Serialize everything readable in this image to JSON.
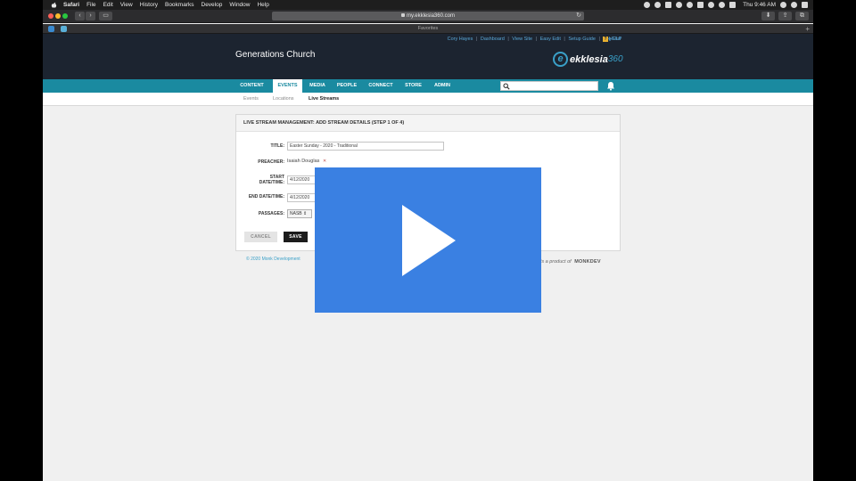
{
  "menubar": {
    "app": "Safari",
    "items": [
      "File",
      "Edit",
      "View",
      "History",
      "Bookmarks",
      "Develop",
      "Window",
      "Help"
    ],
    "clock": "Thu 9:46 AM"
  },
  "toolbar": {
    "url": "my.ekklesia360.com"
  },
  "favorites": {
    "label": "Favorites"
  },
  "header": {
    "user": "Cory Hayes",
    "links": [
      "Dashboard",
      "View Site",
      "Easy Edit",
      "Setup Guide",
      "Log Out"
    ],
    "help": "HELP",
    "church": "Generations Church",
    "brand_name": "ekklesia",
    "brand_num": "360"
  },
  "nav": {
    "items": [
      "CONTENT",
      "EVENTS",
      "MEDIA",
      "PEOPLE",
      "CONNECT",
      "STORE",
      "ADMIN"
    ],
    "active": "EVENTS",
    "search_placeholder": ""
  },
  "subnav": {
    "items": [
      "Events",
      "Locations",
      "Live Streams"
    ],
    "active": "Live Streams"
  },
  "panel": {
    "title": "LIVE STREAM MANAGEMENT: ADD STREAM DETAILS (STEP 1 OF 4)",
    "title_label": "TITLE:",
    "title_value": "Easter Sunday - 2020 - Traditional",
    "preacher_label": "PREACHER:",
    "preacher_value": "Isaiah Douglas",
    "preacher_remove": "✕",
    "start_label_1": "START",
    "start_label_2": "DATE/TIME:",
    "start_date": "4/12/2020",
    "end_label": "END DATE/TIME:",
    "end_date": "4/12/2020",
    "passages_label": "PASSAGES:",
    "passages_version": "NASB ⇕",
    "cancel_label": "CANCEL",
    "save_label": "SAVE"
  },
  "footer": {
    "copyright": "© 2020 Monk Development",
    "product_name": "ekklesia360",
    "product_text": " is a product of ",
    "monk": "MONKDEV"
  },
  "colors": {
    "nav": "#1a8aa0",
    "header": "#1c2430",
    "overlay": "#3a80e2"
  }
}
